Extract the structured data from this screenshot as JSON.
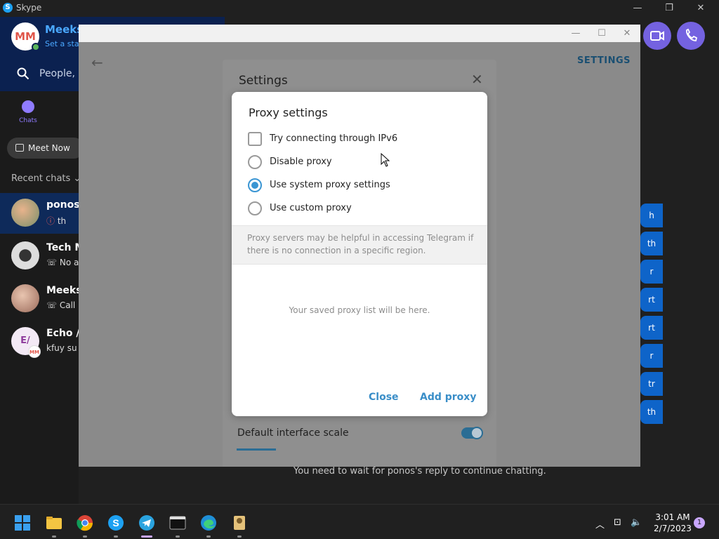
{
  "skype": {
    "title": "Skype",
    "user_initials": "MM",
    "user_name": "Meeks",
    "user_status": "Set a stat",
    "search_placeholder": "People, g",
    "chats_tab": "Chats",
    "meet_now": "Meet Now",
    "recent_chats": "Recent chats",
    "chats": [
      {
        "name": "ponos",
        "message": "th"
      },
      {
        "name": "Tech M",
        "message": "No a"
      },
      {
        "name": "Meeks",
        "message": "Call"
      },
      {
        "name": "Echo /",
        "message": "kfuy su",
        "initials": "E/",
        "sub_initials": "MM"
      }
    ],
    "message_bubbles": [
      "h",
      "th",
      "r",
      "rt",
      "rt",
      "r",
      "tr",
      "th"
    ],
    "wait_message": "You need to wait for ponos's reply to continue chatting."
  },
  "telegram": {
    "settings_label": "SETTINGS",
    "settings_title": "Settings",
    "default_scale_label": "Default interface scale"
  },
  "proxy_dialog": {
    "title": "Proxy settings",
    "ipv6_label": "Try connecting through IPv6",
    "options": [
      "Disable proxy",
      "Use system proxy settings",
      "Use custom proxy"
    ],
    "selected_option": "Use system proxy settings",
    "info_text": "Proxy servers may be helpful in accessing Telegram if there is no connection in a specific region.",
    "empty_text": "Your saved proxy list will be here.",
    "close_label": "Close",
    "add_label": "Add proxy"
  },
  "taskbar": {
    "time": "3:01 AM",
    "date": "2/7/2023",
    "notification_count": "1"
  },
  "colors": {
    "accent": "#3a95d3",
    "skype_header": "#0b2150",
    "skype_purple": "#7462e0"
  }
}
